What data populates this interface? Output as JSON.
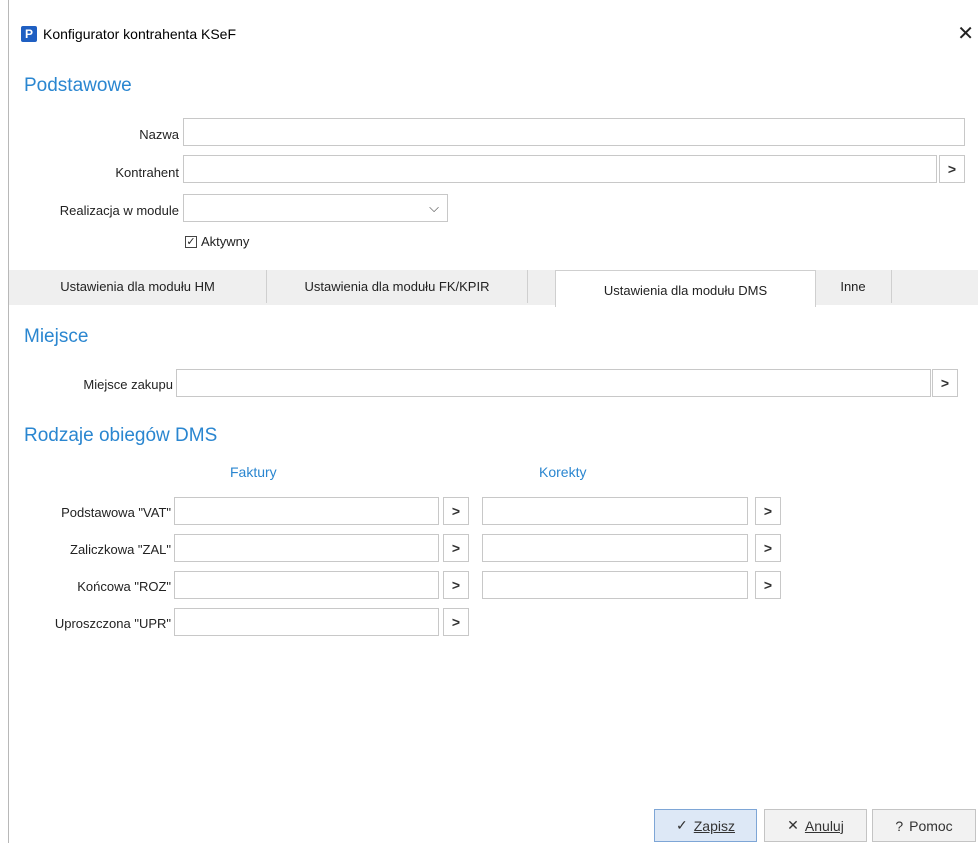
{
  "window": {
    "app_icon": "P",
    "title": "Konfigurator kontrahenta KSeF",
    "close": "✕"
  },
  "basic": {
    "heading": "Podstawowe",
    "nazwa_label": "Nazwa",
    "kontrahent_label": "Kontrahent",
    "realizacja_label": "Realizacja w module",
    "aktywny_label": "Aktywny",
    "aktywny_checked": "✓"
  },
  "tabs": [
    {
      "label": "Ustawienia dla modułu HM"
    },
    {
      "label": "Ustawienia dla modułu FK/KPIR"
    },
    {
      "label": "Ustawienia dla modułu DMS"
    },
    {
      "label": "Inne"
    }
  ],
  "miejsce": {
    "heading": "Miejsce",
    "zakupu_label": "Miejsce zakupu"
  },
  "dms": {
    "heading": "Rodzaje obiegów DMS",
    "col_faktury": "Faktury",
    "col_korekty": "Korekty",
    "rows": [
      {
        "label": "Podstawowa \"VAT\""
      },
      {
        "label": "Zaliczkowa \"ZAL\""
      },
      {
        "label": "Końcowa \"ROZ\""
      },
      {
        "label": "Uproszczona \"UPR\""
      }
    ]
  },
  "footer": {
    "save": "Zapisz",
    "cancel": "Anuluj",
    "help": "Pomoc"
  }
}
